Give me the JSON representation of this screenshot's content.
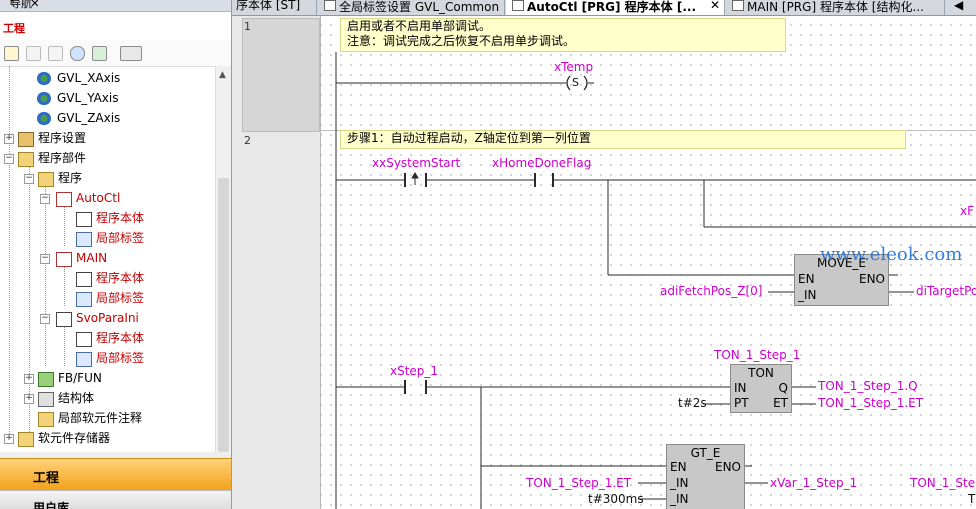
{
  "nav": {
    "title": "导航",
    "title_buttons": "ᵖ ✕",
    "project_label": "工程",
    "tree": [
      {
        "label": "GVL_XAxis"
      },
      {
        "label": "GVL_YAxis"
      },
      {
        "label": "GVL_ZAxis"
      },
      {
        "label": "程序设置"
      },
      {
        "label": "程序部件"
      },
      {
        "label": "程序"
      },
      {
        "label": "AutoCtl"
      },
      {
        "label": "程序本体"
      },
      {
        "label": "局部标签"
      },
      {
        "label": "MAIN"
      },
      {
        "label": "程序本体"
      },
      {
        "label": "局部标签"
      },
      {
        "label": "SvoParaIni"
      },
      {
        "label": "程序本体"
      },
      {
        "label": "局部标签"
      },
      {
        "label": "FB/FUN"
      },
      {
        "label": "结构体"
      },
      {
        "label": "局部软元件注释"
      },
      {
        "label": "软元件存储器"
      }
    ],
    "panel_project": "工程",
    "panel_library": "用户库"
  },
  "tabs": [
    {
      "label": "序本体 [ST]"
    },
    {
      "label": "全局标签设置 GVL_Common"
    },
    {
      "label": "AutoCtl [PRG] 程序本体 [..."
    },
    {
      "label": "MAIN [PRG] 程序本体 [结构化..."
    }
  ],
  "tab_close": "✕",
  "editor": {
    "net1_num": "1",
    "net2_num": "2",
    "comment1_line1": "启用或者不启用单部调试。",
    "comment1_line2": "注意：调试完成之后恢复不启用单步调试。",
    "coil_var": "xTemp",
    "coil_sym": "S",
    "comment2": "步骤1：自动过程启动，Z轴定位到第一列位置",
    "c_systemstart": "xxSystemStart",
    "c_homedone": "xHomeDoneFlag",
    "right_cut_var": "xF",
    "move_title": "MOVE_E",
    "move_en": "EN",
    "move_eno": "ENO",
    "move_in": "_IN",
    "move_in_var": "adiFetchPos_Z[0]",
    "move_out_var": "diTargetPo",
    "c_step1": "xStep_1",
    "ton_inst": "TON_1_Step_1",
    "ton_title": "TON",
    "ton_in": "IN",
    "ton_q": "Q",
    "ton_pt": "PT",
    "ton_et": "ET",
    "ton_pt_val": "t#2s",
    "ton_q_var": "TON_1_Step_1.Q",
    "ton_et_var": "TON_1_Step_1.ET",
    "gte_title": "GT_E",
    "gte_en": "EN",
    "gte_eno": "ENO",
    "gte_in1": "_IN",
    "gte_in2": "_IN",
    "gte_in1_var": "TON_1_Step_1.ET",
    "gte_in2_val": "t#300ms",
    "gte_out_var": "xVar_1_Step_1",
    "right_cut_var2": "TON_1_Ste",
    "right_cut_var3": "T",
    "watermark": "www.eleok.com"
  }
}
